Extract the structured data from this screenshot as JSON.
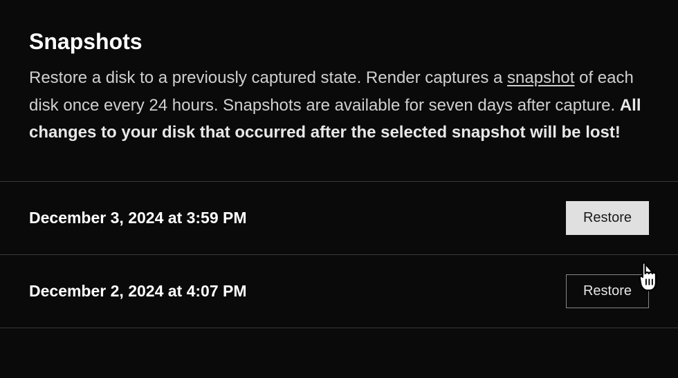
{
  "header": {
    "title": "Snapshots",
    "description_part1": "Restore a disk to a previously captured state. Render captures a ",
    "link_text": "snapshot",
    "description_part2": " of each disk once every 24 hours. Snapshots are available for seven days after capture. ",
    "bold_text": "All changes to your disk that occurred after the selected snapshot will be lost!"
  },
  "snapshots": [
    {
      "date": "December 3, 2024 at 3:59 PM",
      "restore_label": "Restore",
      "hovered": true
    },
    {
      "date": "December 2, 2024 at 4:07 PM",
      "restore_label": "Restore",
      "hovered": false
    }
  ]
}
